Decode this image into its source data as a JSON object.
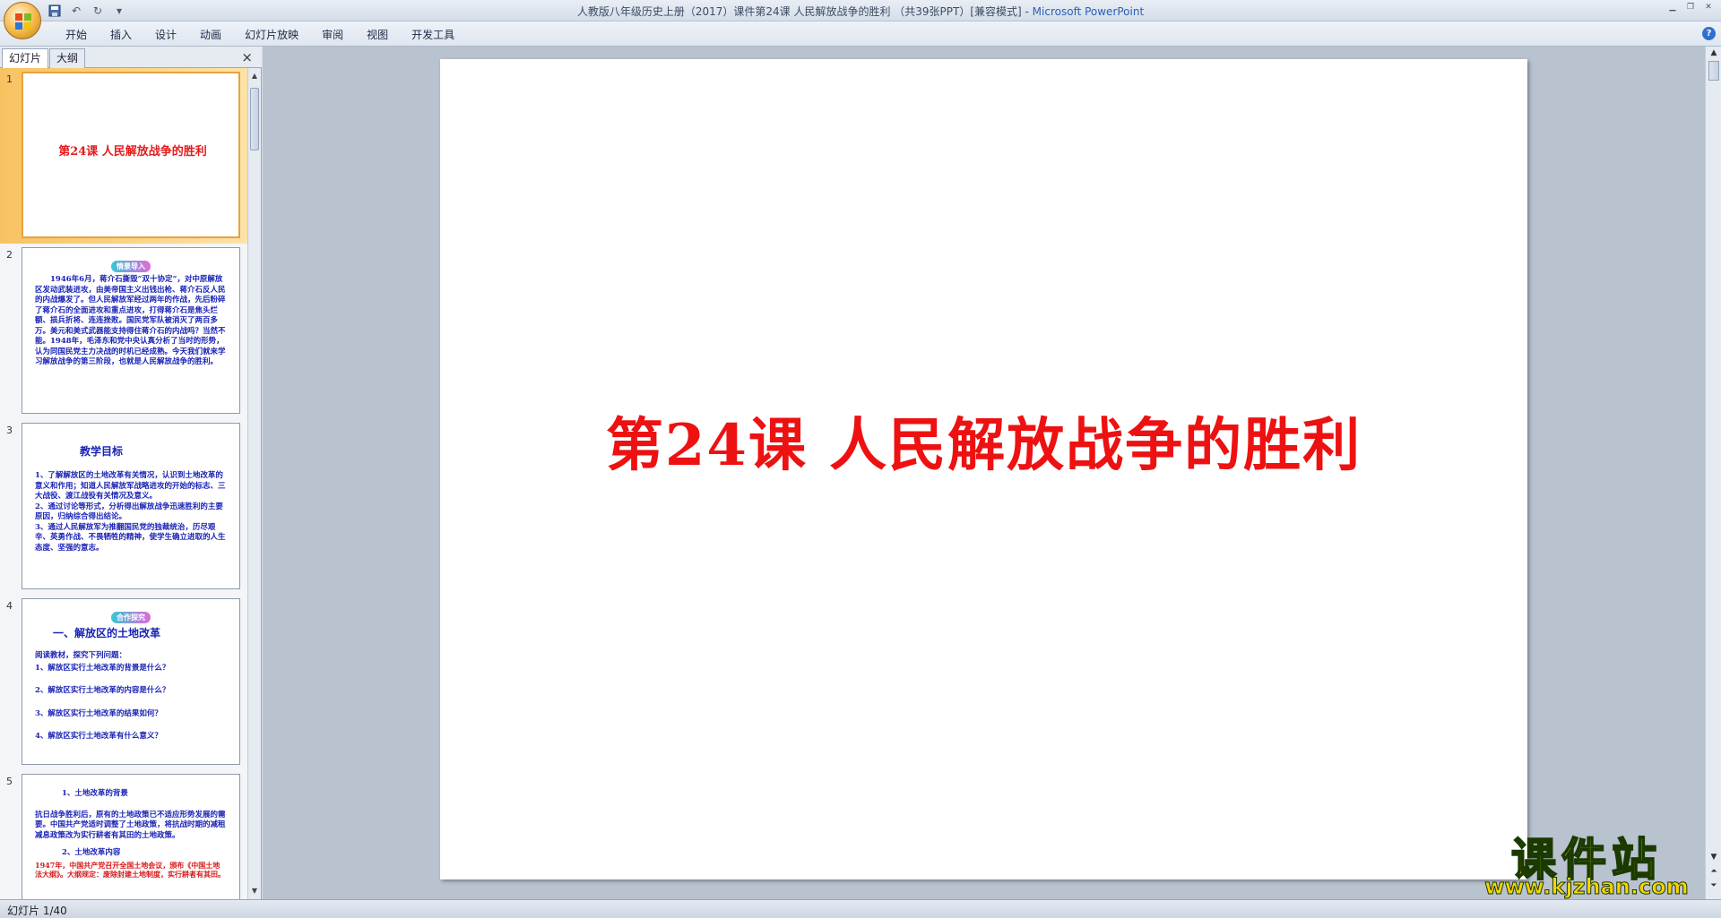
{
  "window": {
    "title_doc": "人教版八年级历史上册（2017）课件第24课 人民解放战争的胜利 （共39张PPT）[兼容模式] - ",
    "title_app": "Microsoft PowerPoint"
  },
  "ribbon": {
    "tabs": [
      "开始",
      "插入",
      "设计",
      "动画",
      "幻灯片放映",
      "审阅",
      "视图",
      "开发工具"
    ]
  },
  "pane": {
    "tab_slides": "幻灯片",
    "tab_outline": "大纲",
    "close": "×"
  },
  "thumbnails": [
    {
      "num": "1",
      "title": "第24课 人民解放战争的胜利"
    },
    {
      "num": "2",
      "badge": "情景导入",
      "text": "1946年6月，蒋介石撕毁“双十协定”，对中原解放区发动武装进攻，由美帝国主义出钱出枪、蒋介石反人民的内战爆发了。但人民解放军经过两年的作战，先后粉碎了蒋介石的全面进攻和重点进攻，打得蒋介石是焦头烂额、损兵折将、连连挫败。国民党军队被消灭了两百多万。美元和美式武器能支持得住蒋介石的内战吗？当然不能。1948年，毛泽东和党中央认真分析了当时的形势，认为同国民党主力决战的时机已经成熟。今天我们就来学习解放战争的第三阶段，也就是人民解放战争的胜利。"
    },
    {
      "num": "3",
      "heading": "教学目标",
      "text": "1、了解解放区的土地改革有关情况，认识到土地改革的意义和作用；知道人民解放军战略进攻的开始的标志、三大战役、渡江战役有关情况及意义。\n2、通过讨论等形式，分析得出解放战争迅速胜利的主要原因，归纳综合得出结论。\n3、通过人民解放军为推翻国民党的独裁统治，历尽艰辛、英勇作战、不畏牺牲的精神，使学生确立进取的人生态度、坚强的意志。"
    },
    {
      "num": "4",
      "badge": "合作探究",
      "heading": "一、解放区的土地改革",
      "lines": [
        "阅读教材，探究下列问题：",
        "1、解放区实行土地改革的背景是什么？",
        "2、解放区实行土地改革的内容是什么？",
        "3、解放区实行土地改革的结果如何？",
        "4、解放区实行土地改革有什么意义？"
      ]
    },
    {
      "num": "5",
      "sub1": "1、土地改革的背景",
      "text": "抗日战争胜利后，原有的土地政策已不适应形势发展的需要。中国共产党适时调整了土地政策，将抗战时期的减租减息政策改为实行耕者有其田的土地政策。",
      "sub2": "2、土地改革内容",
      "red": "1947年，中国共产党召开全国土地会议，颁布《中国土地法大纲》。大纲规定：废除封建土地制度，实行耕者有其田。"
    }
  ],
  "slide": {
    "title": "第24课 人民解放战争的胜利"
  },
  "status": {
    "slide_indicator": "幻灯片 1/40"
  },
  "watermark": {
    "name": "课件站",
    "url": "www.kjzhan.com"
  }
}
